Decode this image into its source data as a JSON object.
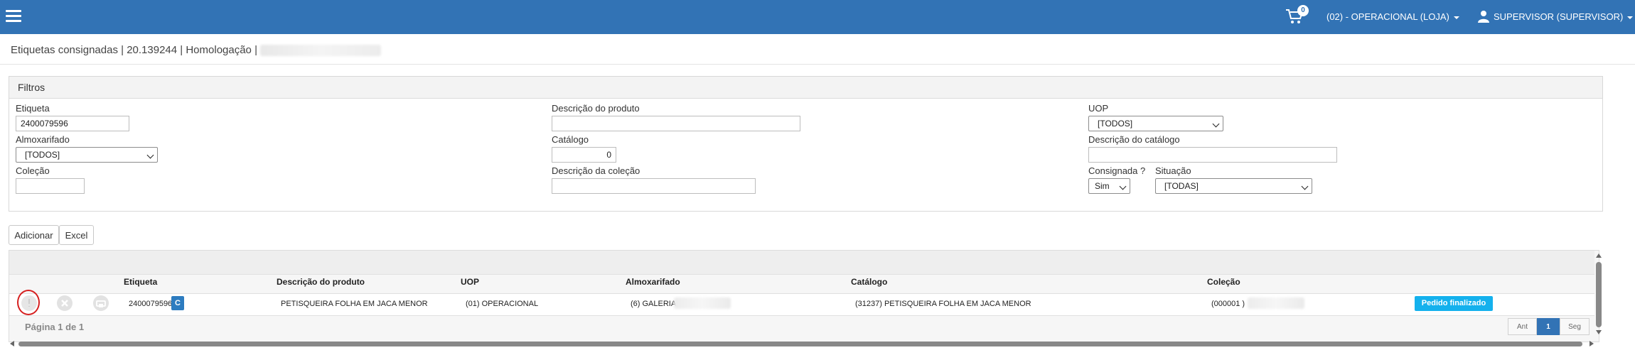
{
  "topbar": {
    "cart_count": "0",
    "unit_label": "(02) - OPERACIONAL (LOJA)",
    "user_label": "SUPERVISOR (SUPERVISOR)",
    "bg_color": "#3273b5"
  },
  "breadcrumb": {
    "title": "Etiquetas consignadas",
    "separator": "|",
    "id": "20.139244",
    "env": "Homologação"
  },
  "filters": {
    "title": "Filtros",
    "etiqueta_label": "Etiqueta",
    "etiqueta_value": "2400079596",
    "descricao_produto_label": "Descrição do produto",
    "descricao_produto_value": "",
    "uop_label": "UOP",
    "uop_value": "[TODOS]",
    "almoxarifado_label": "Almoxarifado",
    "almoxarifado_value": "[TODOS]",
    "catalogo_label": "Catálogo",
    "catalogo_value": "0",
    "descricao_catalogo_label": "Descrição do catálogo",
    "descricao_catalogo_value": "",
    "colecao_label": "Coleção",
    "colecao_value": "",
    "descricao_colecao_label": "Descrição da coleção",
    "descricao_colecao_value": "",
    "consignada_label": "Consignada ?",
    "consignada_value": "Sim",
    "situacao_label": "Situação",
    "situacao_value": "[TODAS]"
  },
  "actions": {
    "add_label": "Adicionar",
    "excel_label": "Excel"
  },
  "grid": {
    "columns": [
      "Etiqueta",
      "Descrição do produto",
      "UOP",
      "Almoxarifado",
      "Catálogo",
      "Coleção"
    ],
    "row": {
      "etiqueta": "2400079596",
      "badge": "C",
      "descricao": "PETISQUEIRA FOLHA EM JACA MENOR",
      "uop": "(01) OPERACIONAL",
      "almoxarifado": "(6) GALERIA",
      "catalogo": "(31237) PETISQUEIRA FOLHA EM JACA MENOR",
      "colecao": "(000001 )",
      "status": "Pedido finalizado"
    },
    "pagination_text": "Página 1 de 1",
    "prev_label": "Ant",
    "page_label": "1",
    "next_label": "Seg"
  }
}
